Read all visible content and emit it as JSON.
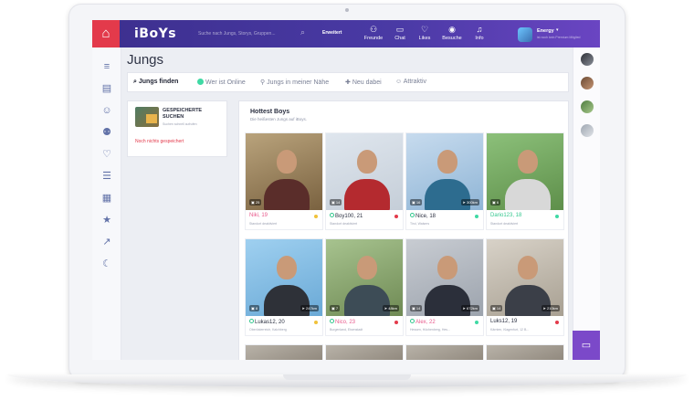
{
  "topbar": {
    "logo": "iBoYs",
    "search_placeholder": "Suche nach Jungs, Storys, Gruppen...",
    "advanced": "Erweitert",
    "nav": [
      {
        "label": "Freunde",
        "icon": "person-icon"
      },
      {
        "label": "Chat",
        "icon": "chat-icon"
      },
      {
        "label": "Likes",
        "icon": "heart-icon"
      },
      {
        "label": "Besuche",
        "icon": "eye-icon"
      },
      {
        "label": "Info",
        "icon": "bell-icon"
      }
    ],
    "user_name": "Energy",
    "user_sub": "ist noch kein Premium Mitglied"
  },
  "page": {
    "title": "Jungs",
    "tabs": [
      {
        "label": "Jungs finden",
        "active": true,
        "icon": "search-icon"
      },
      {
        "label": "Wer ist Online",
        "active": false,
        "icon": "online-dot-icon"
      },
      {
        "label": "Jungs in meiner Nähe",
        "active": false,
        "icon": "pin-icon"
      },
      {
        "label": "Neu dabei",
        "active": false,
        "icon": "add-user-icon"
      },
      {
        "label": "Attraktiv",
        "active": false,
        "icon": "user-icon"
      }
    ]
  },
  "saved": {
    "title": "GESPEICHERTE SUCHEN",
    "subtitle": "Suchen schnell aufrufen",
    "empty": "Noch nichts gespeichert"
  },
  "hottest": {
    "title": "Hottest Boys",
    "subtitle": "Die heißesten Jungs auf iBoys.",
    "cards": [
      {
        "name": "Niki, 19",
        "loc": "Standort deaktiviert",
        "pics": "25",
        "dist": "",
        "online": false,
        "name_color": "pink",
        "status_color": "#f0c23a",
        "photo": [
          "#b9a37c",
          "#7a6240",
          "#5a2d2a"
        ]
      },
      {
        "name": "Boy100, 21",
        "loc": "Standort deaktiviert",
        "pics": "14",
        "dist": "",
        "online": true,
        "name_color": "",
        "status_color": "#e33a4b",
        "photo": [
          "#dfe6ee",
          "#c5ced8",
          "#b42a2f"
        ]
      },
      {
        "name": "Nice, 18",
        "loc": "Tirol, Walsers",
        "pics": "16",
        "dist": "300km",
        "online": true,
        "name_color": "",
        "status_color": "#3fd9a4",
        "photo": [
          "#c7dbee",
          "#8fb5d6",
          "#2d6c8f"
        ]
      },
      {
        "name": "Dario123, 18",
        "loc": "Standort deaktiviert",
        "pics": "6",
        "dist": "",
        "online": false,
        "name_color": "green",
        "status_color": "#3fd9a4",
        "photo": [
          "#8cc07a",
          "#5e8f4a",
          "#d8d8d8"
        ]
      },
      {
        "name": "Lukas12, 20",
        "loc": "Oberösterreich, Kalchberg",
        "pics": "8",
        "dist": "247km",
        "online": true,
        "name_color": "",
        "status_color": "#f0c23a",
        "photo": [
          "#9fd0f0",
          "#6aa9d6",
          "#2e3138"
        ]
      },
      {
        "name": "Nico, 23",
        "loc": "Burgenland, Eisenstadt",
        "pics": "7",
        "dist": "48km",
        "online": true,
        "name_color": "pink",
        "status_color": "#e33a4b",
        "photo": [
          "#a7c38f",
          "#6f8a54",
          "#3d4c56"
        ]
      },
      {
        "name": "Alex, 22",
        "loc": "Hessen, Höchenberg, Hes...",
        "pics": "14",
        "dist": "672km",
        "online": true,
        "name_color": "pink",
        "status_color": "#3fd9a4",
        "photo": [
          "#c8ccd2",
          "#9ca3ad",
          "#2b2f3a"
        ]
      },
      {
        "name": "Luks12, 19",
        "loc": "Kärnten, Klagenfurt, 12 B...",
        "pics": "14",
        "dist": "210km",
        "online": false,
        "name_color": "",
        "status_color": "#e33a4b",
        "photo": [
          "#d8d2c8",
          "#a8a092",
          "#3b3f48"
        ]
      }
    ]
  }
}
